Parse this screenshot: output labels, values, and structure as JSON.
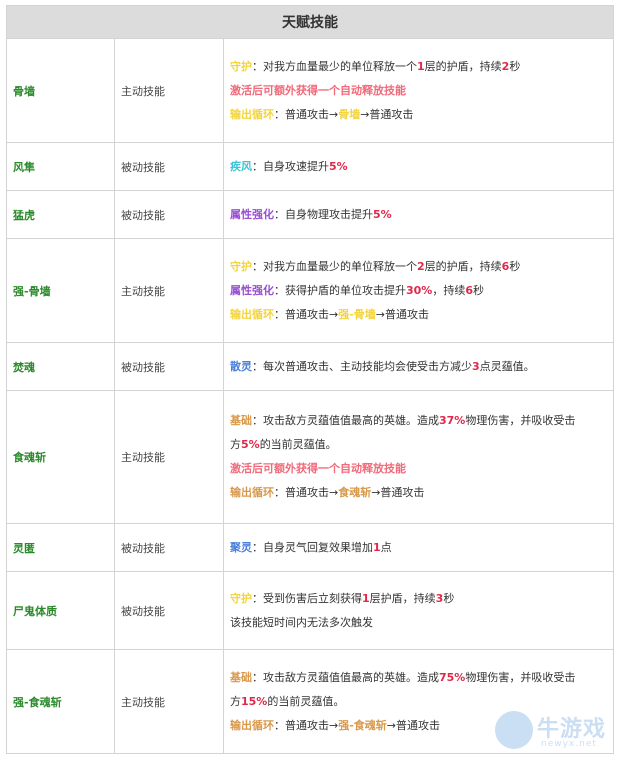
{
  "table": {
    "title": "天赋技能",
    "rows": [
      {
        "name": "骨墙",
        "type": "主动技能",
        "lines": [
          [
            {
              "t": "守护",
              "c": "yellow"
            },
            {
              "t": "：对我方血量最少的单位释放一个"
            },
            {
              "t": "1",
              "c": "red"
            },
            {
              "t": "层的护盾，持续"
            },
            {
              "t": "2",
              "c": "red"
            },
            {
              "t": "秒"
            }
          ],
          [
            {
              "t": "激活后可额外获得一个自动释放技能",
              "c": "pink"
            }
          ],
          [
            {
              "t": "输出循环",
              "c": "yellow"
            },
            {
              "t": "：普通攻击→"
            },
            {
              "t": "骨墙",
              "c": "yellow"
            },
            {
              "t": "→普通攻击"
            }
          ]
        ]
      },
      {
        "name": "风隼",
        "type": "被动技能",
        "lines": [
          [
            {
              "t": "疾风",
              "c": "cyan"
            },
            {
              "t": "：自身攻速提升"
            },
            {
              "t": "5%",
              "c": "red"
            }
          ]
        ]
      },
      {
        "name": "猛虎",
        "type": "被动技能",
        "lines": [
          [
            {
              "t": "属性强化",
              "c": "purple"
            },
            {
              "t": "：自身物理攻击提升"
            },
            {
              "t": "5%",
              "c": "red"
            }
          ]
        ]
      },
      {
        "name": "强-骨墙",
        "type": "主动技能",
        "lines": [
          [
            {
              "t": "守护",
              "c": "yellow"
            },
            {
              "t": "：对我方血量最少的单位释放一个"
            },
            {
              "t": "2",
              "c": "red"
            },
            {
              "t": "层的护盾，持续"
            },
            {
              "t": "6",
              "c": "red"
            },
            {
              "t": "秒"
            }
          ],
          [
            {
              "t": "属性强化",
              "c": "purple"
            },
            {
              "t": "：获得护盾的单位攻击提升"
            },
            {
              "t": "30%",
              "c": "red"
            },
            {
              "t": "，持续"
            },
            {
              "t": "6",
              "c": "red"
            },
            {
              "t": "秒"
            }
          ],
          [
            {
              "t": "输出循环",
              "c": "yellow"
            },
            {
              "t": "：普通攻击→"
            },
            {
              "t": "强-骨墙",
              "c": "yellow"
            },
            {
              "t": "→普通攻击"
            }
          ]
        ]
      },
      {
        "name": "焚魂",
        "type": "被动技能",
        "lines": [
          [
            {
              "t": "散灵",
              "c": "blue"
            },
            {
              "t": "：每次普通攻击、主动技能均会使受击方减少"
            },
            {
              "t": "3",
              "c": "red"
            },
            {
              "t": "点灵蕴值。"
            }
          ]
        ]
      },
      {
        "name": "食魂斩",
        "type": "主动技能",
        "lines": [
          [
            {
              "t": "基础",
              "c": "orange"
            },
            {
              "t": "：攻击敌方灵蕴值值最高的英雄。造成"
            },
            {
              "t": "37%",
              "c": "red"
            },
            {
              "t": "物理伤害，并吸收受击"
            }
          ],
          [
            {
              "t": "方"
            },
            {
              "t": "5%",
              "c": "red"
            },
            {
              "t": "的当前灵蕴值。"
            }
          ],
          [
            {
              "t": "激活后可额外获得一个自动释放技能",
              "c": "pink"
            }
          ],
          [
            {
              "t": "输出循环",
              "c": "orange"
            },
            {
              "t": "：普通攻击→"
            },
            {
              "t": "食魂斩",
              "c": "orange"
            },
            {
              "t": "→普通攻击"
            }
          ]
        ]
      },
      {
        "name": "灵匿",
        "type": "被动技能",
        "lines": [
          [
            {
              "t": "聚灵",
              "c": "blue"
            },
            {
              "t": "：自身灵气回复效果增加"
            },
            {
              "t": "1",
              "c": "red"
            },
            {
              "t": "点"
            }
          ]
        ]
      },
      {
        "name": "尸鬼体质",
        "type": "被动技能",
        "lines": [
          [
            {
              "t": "守护",
              "c": "yellow"
            },
            {
              "t": "：受到伤害后立刻获得"
            },
            {
              "t": "1",
              "c": "red"
            },
            {
              "t": "层护盾，持续"
            },
            {
              "t": "3",
              "c": "red"
            },
            {
              "t": "秒"
            }
          ],
          [
            {
              "t": "该技能短时间内无法多次触发"
            }
          ]
        ]
      },
      {
        "name": "强-食魂斩",
        "type": "主动技能",
        "lines": [
          [
            {
              "t": "基础",
              "c": "orange"
            },
            {
              "t": "：攻击敌方灵蕴值值最高的英雄。造成"
            },
            {
              "t": "75%",
              "c": "red"
            },
            {
              "t": "物理伤害，并吸收受击"
            }
          ],
          [
            {
              "t": "方"
            },
            {
              "t": "15%",
              "c": "red"
            },
            {
              "t": "的当前灵蕴值。"
            }
          ],
          [
            {
              "t": "输出循环",
              "c": "orange"
            },
            {
              "t": "：普通攻击→"
            },
            {
              "t": "强-食魂斩",
              "c": "orange"
            },
            {
              "t": "→普通攻击"
            }
          ]
        ]
      }
    ]
  },
  "watermark": {
    "text": "牛游戏",
    "sub": "newyx.net"
  },
  "colors": {
    "name": "#2a8a2a",
    "yellow": "#f3d43a",
    "pink": "#f06a7a",
    "red": "#e0284a",
    "cyan": "#3cc3d6",
    "purple": "#9a4fd1",
    "orange": "#d9984a",
    "blue": "#4a7fd9"
  }
}
